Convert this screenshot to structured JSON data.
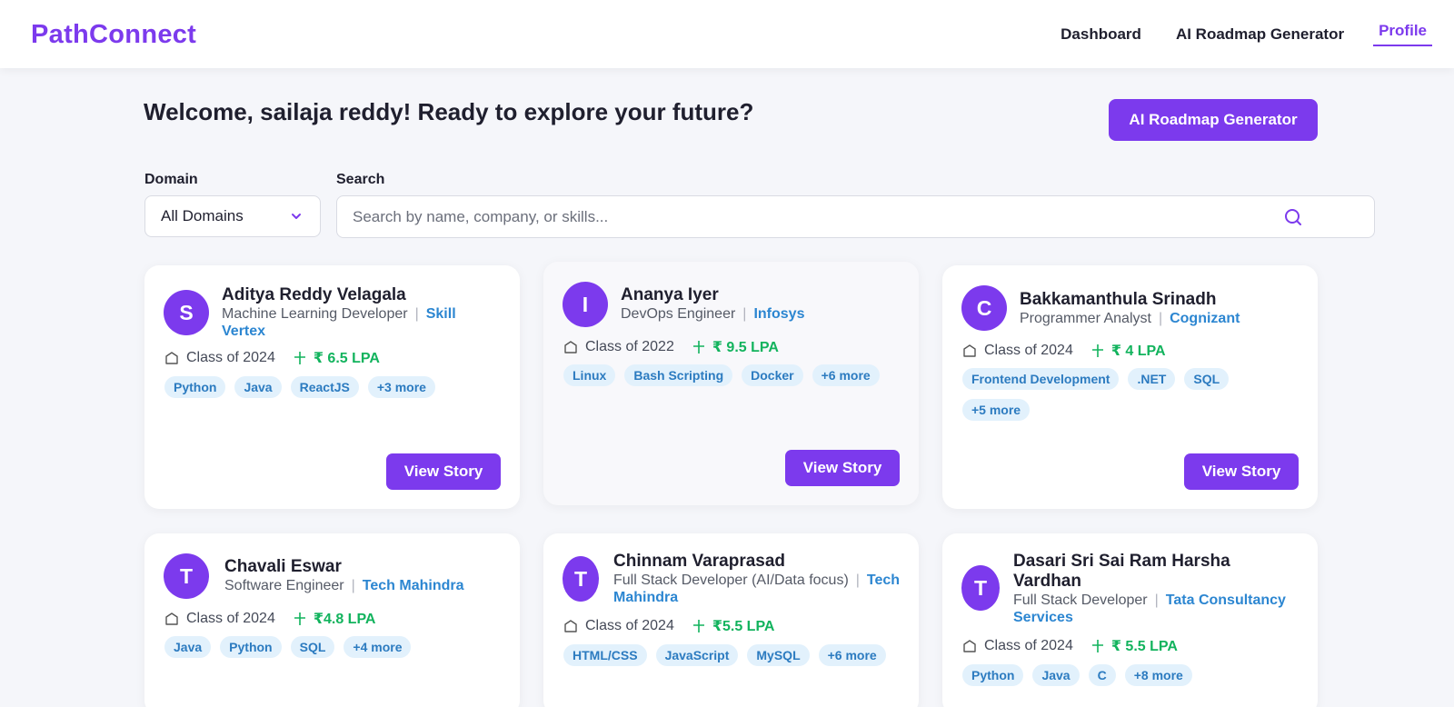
{
  "brand": "PathConnect",
  "nav": [
    "Dashboard",
    "AI Roadmap Generator",
    "Profile"
  ],
  "welcome": "Welcome, sailaja reddy! Ready to explore your future?",
  "cta_label": "AI Roadmap Generator",
  "filters": {
    "domain_label": "Domain",
    "domain_value": "All Domains",
    "search_label": "Search",
    "search_placeholder": "Search by name, company, or skills..."
  },
  "view_label": "View Story",
  "accent_color": "#7c3aed",
  "cards": [
    {
      "initial": "S",
      "name": "Aditya Reddy Velagala",
      "role": "Machine Learning Developer",
      "company": "Skill Vertex",
      "class_of": "Class of 2024",
      "package": "₹ 6.5 LPA",
      "tags": [
        "Python",
        "Java",
        "ReactJS",
        "+3 more"
      ]
    },
    {
      "initial": "I",
      "name": "Ananya Iyer",
      "role": "DevOps Engineer",
      "company": "Infosys",
      "class_of": "Class of 2022",
      "package": "₹ 9.5 LPA",
      "tags": [
        "Linux",
        "Bash Scripting",
        "Docker",
        "+6 more"
      ]
    },
    {
      "initial": "C",
      "name": "Bakkamanthula Srinadh",
      "role": "Programmer Analyst",
      "company": "Cognizant",
      "class_of": "Class of 2024",
      "package": "₹ 4 LPA",
      "tags": [
        "Frontend Development",
        ".NET",
        "SQL",
        "+5 more"
      ]
    },
    {
      "initial": "T",
      "name": "Chavali Eswar",
      "role": "Software Engineer",
      "company": "Tech Mahindra",
      "class_of": "Class of 2024",
      "package": "₹4.8 LPA",
      "tags": [
        "Java",
        "Python",
        "SQL",
        "+4 more"
      ]
    },
    {
      "initial": "T",
      "name": "Chinnam Varaprasad",
      "role": "Full Stack Developer (AI/Data focus)",
      "company": "Tech Mahindra",
      "class_of": "Class of 2024",
      "package": "₹5.5 LPA",
      "tags": [
        "HTML/CSS",
        "JavaScript",
        "MySQL",
        "+6 more"
      ]
    },
    {
      "initial": "T",
      "name": "Dasari Sri Sai Ram Harsha Vardhan",
      "role": "Full Stack Developer",
      "company": "Tata Consultancy Services",
      "class_of": "Class of 2024",
      "package": "₹ 5.5 LPA",
      "tags": [
        "Python",
        "Java",
        "C",
        "+8 more"
      ]
    }
  ]
}
